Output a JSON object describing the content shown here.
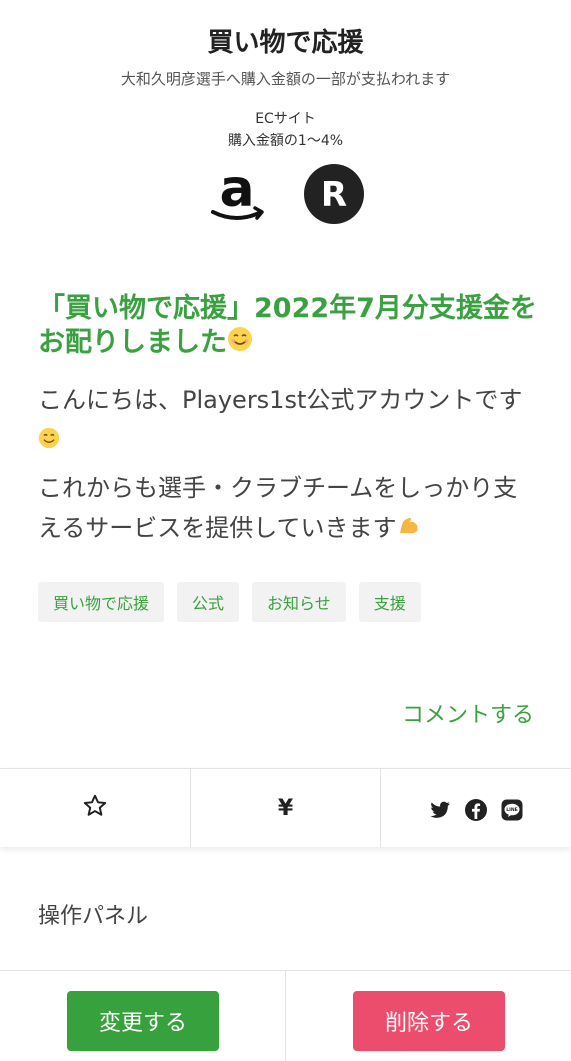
{
  "shop": {
    "title": "買い物で応援",
    "subtitle": "大和久明彦選手へ購入金額の一部が支払われます",
    "ec_label": "ECサイト",
    "ec_rate": "購入金額の1〜4%",
    "stores": [
      "amazon",
      "rakuten"
    ]
  },
  "post": {
    "title": "「買い物で応援」2022年7月分支援金をお配りしました",
    "para1": "こんにちは、Players1st公式アカウントです",
    "para2": "これからも選手・クラブチームをしっかり支えるサービスを提供していきます",
    "tags": [
      "買い物で応援",
      "公式",
      "お知らせ",
      "支援"
    ]
  },
  "comment_link": "コメントする",
  "actions": {
    "yen": "¥",
    "icons": [
      "star-icon",
      "twitter-icon",
      "facebook-icon",
      "line-icon"
    ]
  },
  "panel": {
    "label": "操作パネル",
    "change_label": "変更する",
    "delete_label": "削除する"
  },
  "colors": {
    "accent": "#3aa140",
    "danger": "#ec4d6c"
  }
}
